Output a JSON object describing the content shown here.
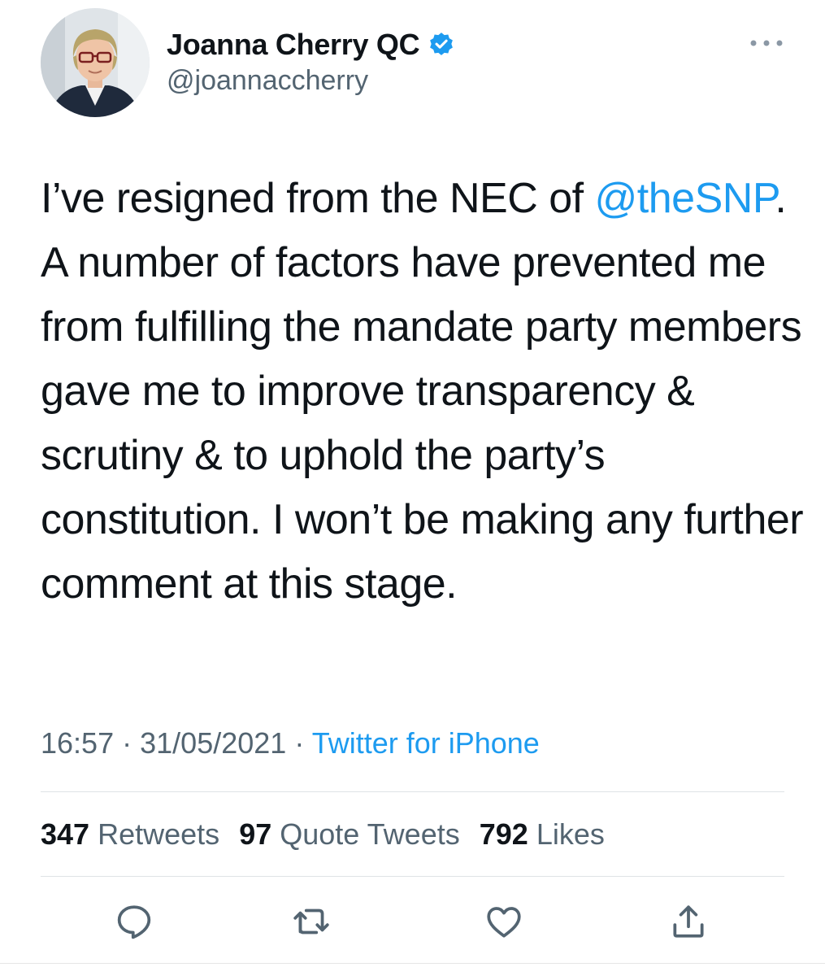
{
  "author": {
    "display_name": "Joanna Cherry QC",
    "handle": "@joannaccherry",
    "verified_icon": "verified-badge-icon",
    "avatar_icon": "profile-photo"
  },
  "tweet": {
    "text_parts": {
      "before": "I’ve resigned from the NEC of ",
      "mention": "@theSNP",
      "after": ". A number of factors have prevented me from fulfilling the mandate party members gave me to improve transparency & scrutiny & to uphold the party’s constitution. I won’t be making any further comment at this stage."
    },
    "time": "16:57",
    "date": "31/05/2021",
    "separator": "·",
    "source": "Twitter for iPhone"
  },
  "stats": {
    "retweets_count": "347",
    "retweets_label": "Retweets",
    "quotes_count": "97",
    "quotes_label": "Quote Tweets",
    "likes_count": "792",
    "likes_label": "Likes"
  },
  "actions": [
    "reply-icon",
    "retweet-icon",
    "like-icon",
    "share-icon"
  ],
  "colors": {
    "accent": "#1d9bf0",
    "text": "#0f1419",
    "secondary": "#536471",
    "divider": "#dfe3e6"
  }
}
